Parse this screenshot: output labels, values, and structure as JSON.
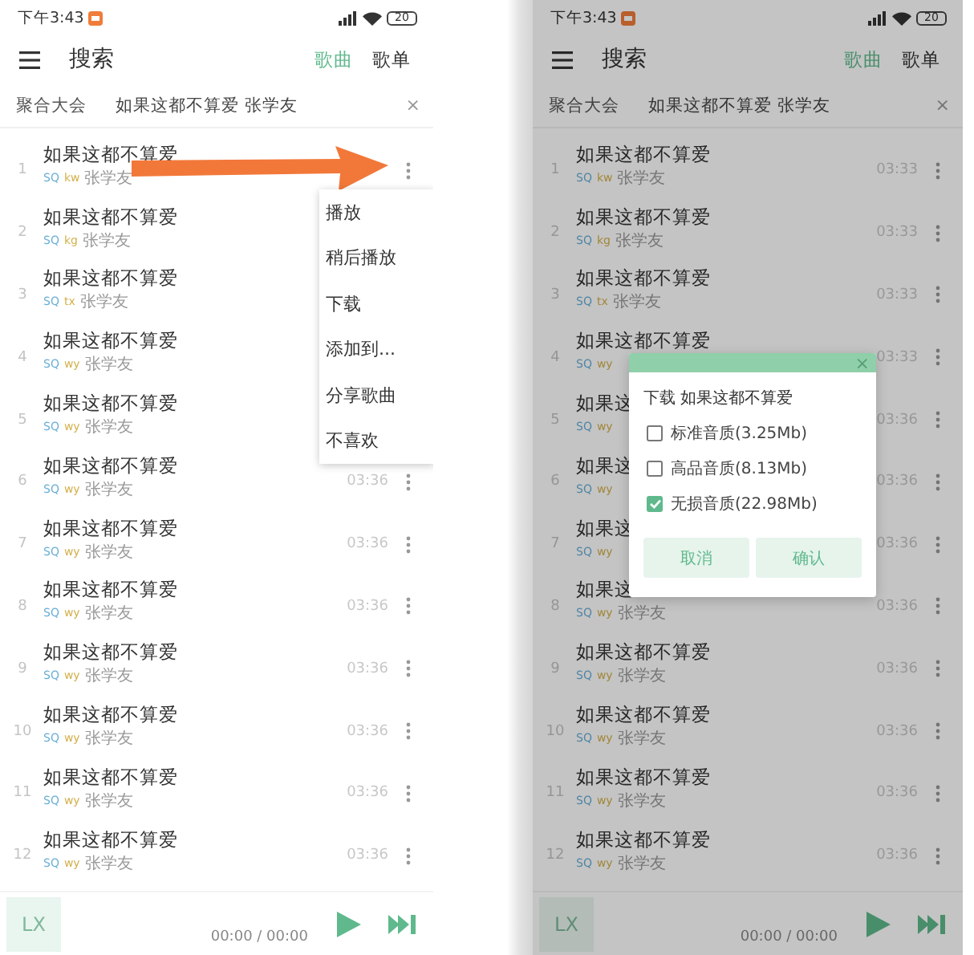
{
  "screens": [
    {
      "status_bar": {
        "time": "下午3:43",
        "battery": "20"
      },
      "header": {
        "title": "搜索",
        "tabs": [
          {
            "label": "歌曲",
            "selected": true
          },
          {
            "label": "歌单",
            "selected": false
          }
        ]
      },
      "search": {
        "source": "聚合大会",
        "value": "如果这都不算爱 张学友",
        "clear": "×"
      },
      "songs": [
        {
          "number": "1",
          "title": "如果这都不算爱",
          "quality": "SQ",
          "source": "kw",
          "artist": "张学友",
          "menu_button": true
        },
        {
          "number": "2",
          "title": "如果这都不算爱",
          "quality": "SQ",
          "source": "kg",
          "artist": "张学友",
          "menu_button": false
        },
        {
          "number": "3",
          "title": "如果这都不算爱",
          "quality": "SQ",
          "source": "tx",
          "artist": "张学友",
          "menu_button": false
        },
        {
          "number": "4",
          "title": "如果这都不算爱",
          "quality": "SQ",
          "source": "wy",
          "artist": "张学友",
          "menu_button": false
        },
        {
          "number": "5",
          "title": "如果这都不算爱",
          "quality": "SQ",
          "source": "wy",
          "artist": "张学友",
          "menu_button": false
        },
        {
          "number": "6",
          "title": "如果这都不算爱",
          "quality": "SQ",
          "source": "wy",
          "artist": "张学友",
          "duration": "03:36",
          "menu_button": true
        },
        {
          "number": "7",
          "title": "如果这都不算爱",
          "quality": "SQ",
          "source": "wy",
          "artist": "张学友",
          "duration": "03:36",
          "menu_button": true
        },
        {
          "number": "8",
          "title": "如果这都不算爱",
          "quality": "SQ",
          "source": "wy",
          "artist": "张学友",
          "duration": "03:36",
          "menu_button": true
        },
        {
          "number": "9",
          "title": "如果这都不算爱",
          "quality": "SQ",
          "source": "wy",
          "artist": "张学友",
          "duration": "03:36",
          "menu_button": true
        },
        {
          "number": "10",
          "title": "如果这都不算爱",
          "quality": "SQ",
          "source": "wy",
          "artist": "张学友",
          "duration": "03:36",
          "menu_button": true
        },
        {
          "number": "11",
          "title": "如果这都不算爱",
          "quality": "SQ",
          "source": "wy",
          "artist": "张学友",
          "duration": "03:36",
          "menu_button": true
        },
        {
          "number": "12",
          "title": "如果这都不算爱",
          "quality": "SQ",
          "source": "wy",
          "artist": "张学友",
          "duration": "03:36",
          "menu_button": true
        }
      ],
      "context_menu": {
        "items": [
          "播放",
          "稍后播放",
          "下载",
          "添加到...",
          "分享歌曲",
          "不喜欢"
        ]
      },
      "player": {
        "logo": "LX",
        "time": "00:00 / 00:00"
      }
    },
    {
      "status_bar": {
        "time": "下午3:43",
        "battery": "20"
      },
      "header": {
        "title": "搜索",
        "tabs": [
          {
            "label": "歌曲",
            "selected": true
          },
          {
            "label": "歌单",
            "selected": false
          }
        ]
      },
      "search": {
        "source": "聚合大会",
        "value": "如果这都不算爱 张学友",
        "clear": "×"
      },
      "songs": [
        {
          "number": "1",
          "title": "如果这都不算爱",
          "quality": "SQ",
          "source": "kw",
          "artist": "张学友",
          "duration": "03:33",
          "menu_button": true
        },
        {
          "number": "2",
          "title": "如果这都不算爱",
          "quality": "SQ",
          "source": "kg",
          "artist": "张学友",
          "duration": "03:33",
          "menu_button": true
        },
        {
          "number": "3",
          "title": "如果这都不算爱",
          "quality": "SQ",
          "source": "tx",
          "artist": "张学友",
          "duration": "03:33",
          "menu_button": true
        },
        {
          "number": "4",
          "title": "如果这都不算爱",
          "quality": "SQ",
          "source": "wy",
          "duration": "03:33",
          "menu_button": true
        },
        {
          "number": "5",
          "title": "如果这",
          "quality": "SQ",
          "source": "wy",
          "duration": "03:36",
          "menu_button": true
        },
        {
          "number": "6",
          "title": "如果这",
          "quality": "SQ",
          "source": "wy",
          "duration": "03:36",
          "menu_button": true
        },
        {
          "number": "7",
          "title": "如果这",
          "quality": "SQ",
          "source": "wy",
          "duration": "03:36",
          "menu_button": true
        },
        {
          "number": "8",
          "title": "如果这",
          "quality": "SQ",
          "source": "wy",
          "artist": "张学友",
          "duration": "03:36",
          "menu_button": true
        },
        {
          "number": "9",
          "title": "如果这都不算爱",
          "quality": "SQ",
          "source": "wy",
          "artist": "张学友",
          "duration": "03:36",
          "menu_button": true
        },
        {
          "number": "10",
          "title": "如果这都不算爱",
          "quality": "SQ",
          "source": "wy",
          "artist": "张学友",
          "duration": "03:36",
          "menu_button": true
        },
        {
          "number": "11",
          "title": "如果这都不算爱",
          "quality": "SQ",
          "source": "wy",
          "artist": "张学友",
          "duration": "03:36",
          "menu_button": true
        },
        {
          "number": "12",
          "title": "如果这都不算爱",
          "quality": "SQ",
          "source": "wy",
          "artist": "张学友",
          "duration": "03:36",
          "menu_button": true
        }
      ],
      "dialog": {
        "close": "×",
        "title": "下载 如果这都不算爱",
        "options": [
          {
            "label": "标准音质(3.25Mb)",
            "checked": false
          },
          {
            "label": "高品音质(8.13Mb)",
            "checked": false
          },
          {
            "label": "无损音质(22.98Mb)",
            "checked": true
          }
        ],
        "buttons": [
          "取消",
          "确认"
        ]
      },
      "player": {
        "logo": "LX",
        "time": "00:00 / 00:00"
      }
    }
  ]
}
